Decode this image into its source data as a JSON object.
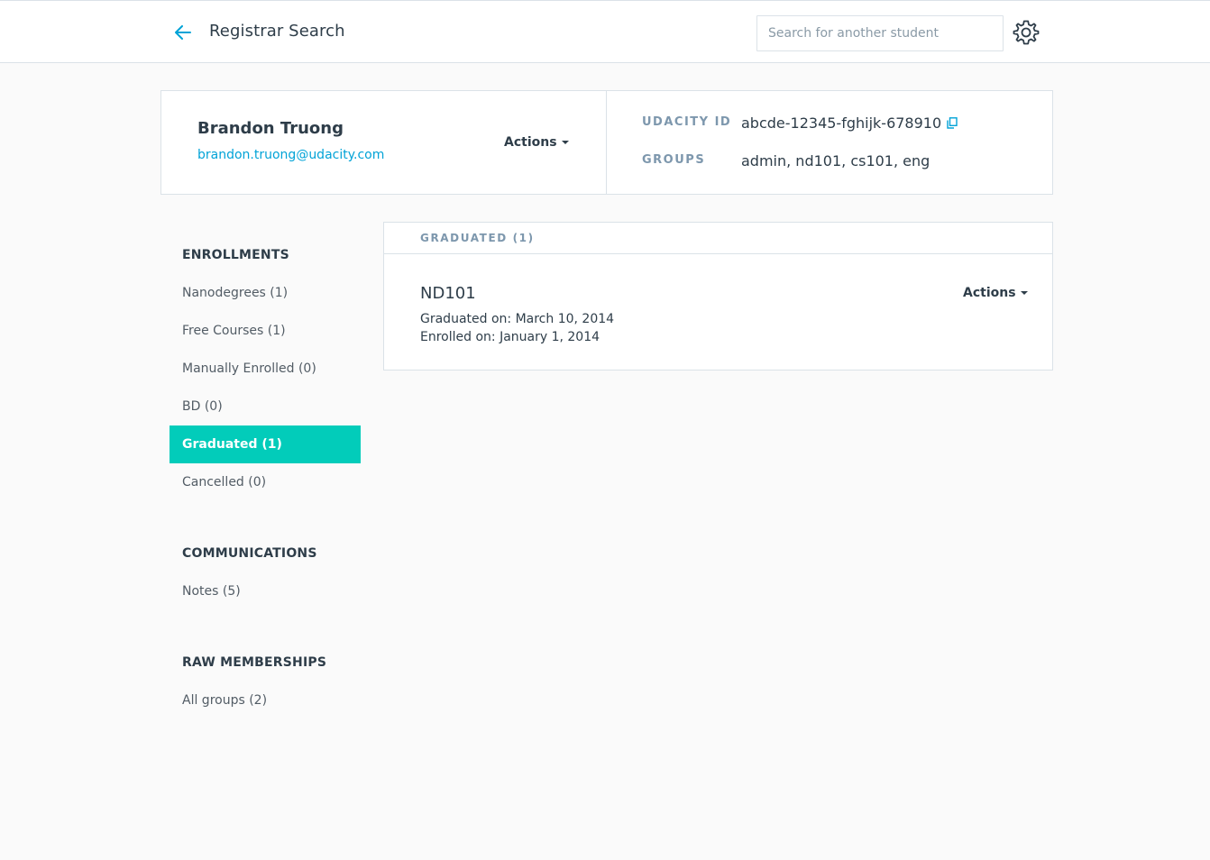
{
  "header": {
    "title": "Registrar Search",
    "search_placeholder": "Search for another student",
    "search_value": ""
  },
  "student": {
    "name": "Brandon Truong",
    "email": "brandon.truong@udacity.com",
    "actions_label": "Actions",
    "udacity_id_label": "UDACITY ID",
    "udacity_id": "abcde-12345-fghijk-678910",
    "groups_label": "GROUPS",
    "groups": "admin, nd101, cs101, eng"
  },
  "sidebar": {
    "enrollments_title": "ENROLLMENTS",
    "enrollments": [
      {
        "label": "Nanodegrees (1)"
      },
      {
        "label": "Free Courses (1)"
      },
      {
        "label": "Manually Enrolled (0)"
      },
      {
        "label": "BD (0)"
      },
      {
        "label": "Graduated (1)"
      },
      {
        "label": "Cancelled (0)"
      }
    ],
    "communications_title": "COMMUNICATIONS",
    "communications": [
      {
        "label": "Notes (5)"
      }
    ],
    "raw_title": "RAW MEMBERSHIPS",
    "raw": [
      {
        "label": "All groups (2)"
      }
    ]
  },
  "content": {
    "section_title": "GRADUATED (1)",
    "enrollment": {
      "title": "ND101",
      "graduated_on": "Graduated on: March 10, 2014",
      "enrolled_on": "Enrolled on: January 1, 2014",
      "actions_label": "Actions"
    }
  },
  "colors": {
    "accent": "#02ccba",
    "link": "#02a3d7",
    "label": "#7d97ad",
    "text": "#2e3d49"
  },
  "icons": {
    "back": "arrow-left-icon",
    "settings": "gear-icon",
    "copy": "copy-icon",
    "caret": "caret-down-icon"
  }
}
